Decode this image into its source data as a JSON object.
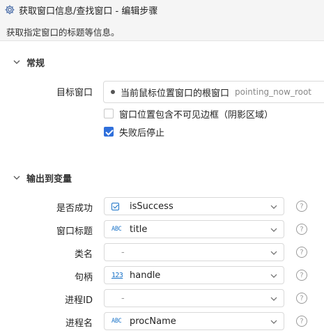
{
  "header": {
    "title": "获取窗口信息/查找窗口  -  编辑步骤",
    "subtitle": "获取指定窗口的标题等信息。",
    "icon": "gear-icon"
  },
  "general": {
    "section_title": "常规",
    "target_label": "目标窗口",
    "target_value": "当前鼠标位置窗口的根窗口",
    "target_code": "pointing_now_root",
    "option_border_label": "窗口位置包含不可见边框（阴影区域）",
    "option_border_checked": false,
    "option_stop_label": "失败后停止",
    "option_stop_checked": true
  },
  "output": {
    "section_title": "输出到变量",
    "rows": [
      {
        "label": "是否成功",
        "type": "bool",
        "type_text": "",
        "value": "isSuccess"
      },
      {
        "label": "窗口标题",
        "type": "text",
        "type_text": "ABC",
        "value": "title"
      },
      {
        "label": "类名",
        "type": "none",
        "type_text": "",
        "value": "-"
      },
      {
        "label": "句柄",
        "type": "number",
        "type_text": "123",
        "value": "handle"
      },
      {
        "label": "进程ID",
        "type": "none",
        "type_text": "",
        "value": "-"
      },
      {
        "label": "进程名",
        "type": "text",
        "type_text": "ABC",
        "value": "procName"
      }
    ],
    "help_glyph": "?"
  },
  "colors": {
    "accent": "#2f6fdb",
    "type_icon": "#1a73c8",
    "header_bg": "#f5f5f5"
  }
}
